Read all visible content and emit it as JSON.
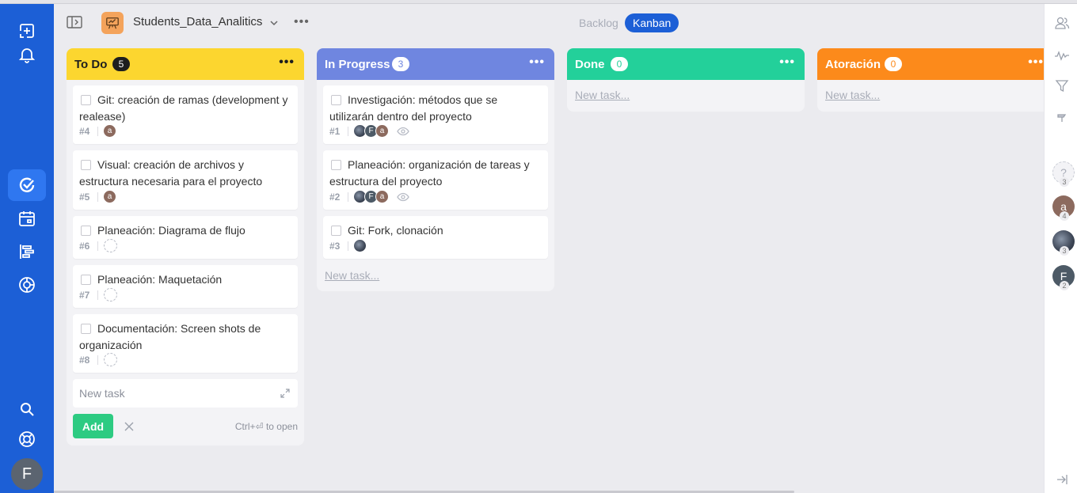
{
  "header": {
    "project_title": "Students_Data_Analitics",
    "more_label": "•••",
    "views": [
      "Backlog",
      "Kanban"
    ],
    "active_view": "Kanban"
  },
  "leftnav": {
    "items": [
      {
        "name": "add-task-icon"
      },
      {
        "name": "bell-icon"
      },
      {
        "name": "my-tasks-icon",
        "active": true
      },
      {
        "name": "calendar-icon"
      },
      {
        "name": "timeline-icon"
      },
      {
        "name": "reports-icon"
      },
      {
        "name": "search-icon"
      },
      {
        "name": "help-icon"
      }
    ],
    "user_initial": "F"
  },
  "columns": [
    {
      "title": "To Do",
      "count": "5",
      "color": "#fcd62f",
      "menu": "•••",
      "cards": [
        {
          "text": "Git: creación de ramas (development y realease)",
          "number": "#4",
          "avatars": [
            "a"
          ]
        },
        {
          "text": "Visual: creación de archivos y estructura necesaria para el proyecto",
          "number": "#5",
          "avatars": [
            "a"
          ]
        },
        {
          "text": "Planeación: Diagrama de flujo",
          "number": "#6",
          "avatars": []
        },
        {
          "text": "Planeación: Maquetación",
          "number": "#7",
          "avatars": []
        },
        {
          "text": "Documentación: Screen shots de organización",
          "number": "#8",
          "avatars": []
        }
      ],
      "new_task_placeholder": "New task",
      "add_label": "Add",
      "hint": "Ctrl+⏎ to open"
    },
    {
      "title": "In Progress",
      "count": "3",
      "color": "#6f86e0",
      "menu": "•••",
      "cards": [
        {
          "text": "Investigación: métodos que se utilizarán dentro del proyecto",
          "number": "#1",
          "avatars": [
            "photo",
            "F",
            "a"
          ],
          "watch": true
        },
        {
          "text": "Planeación: organización de tareas y estructura del proyecto",
          "number": "#2",
          "avatars": [
            "photo",
            "F",
            "a"
          ],
          "watch": true
        },
        {
          "text": "Git: Fork, clonación",
          "number": "#3",
          "avatars": [
            "photo"
          ]
        }
      ],
      "new_task_link": "New task..."
    },
    {
      "title": "Done",
      "count": "0",
      "color": "#23d09a",
      "menu": "•••",
      "cards": [],
      "new_task_link": "New task..."
    },
    {
      "title": "Atoración",
      "count": "0",
      "color": "#fc8a1b",
      "menu": "•••",
      "cards": [],
      "new_task_link": "New task..."
    }
  ],
  "rightpanel": {
    "icons": [
      "members-icon",
      "activity-icon",
      "filter-icon",
      "pin-icon",
      "collapse-panel-icon"
    ],
    "assignees": [
      {
        "label": "?",
        "count": "3"
      },
      {
        "label": "a",
        "count": "4"
      },
      {
        "label": "",
        "count": "3"
      },
      {
        "label": "F",
        "count": "2"
      }
    ]
  }
}
